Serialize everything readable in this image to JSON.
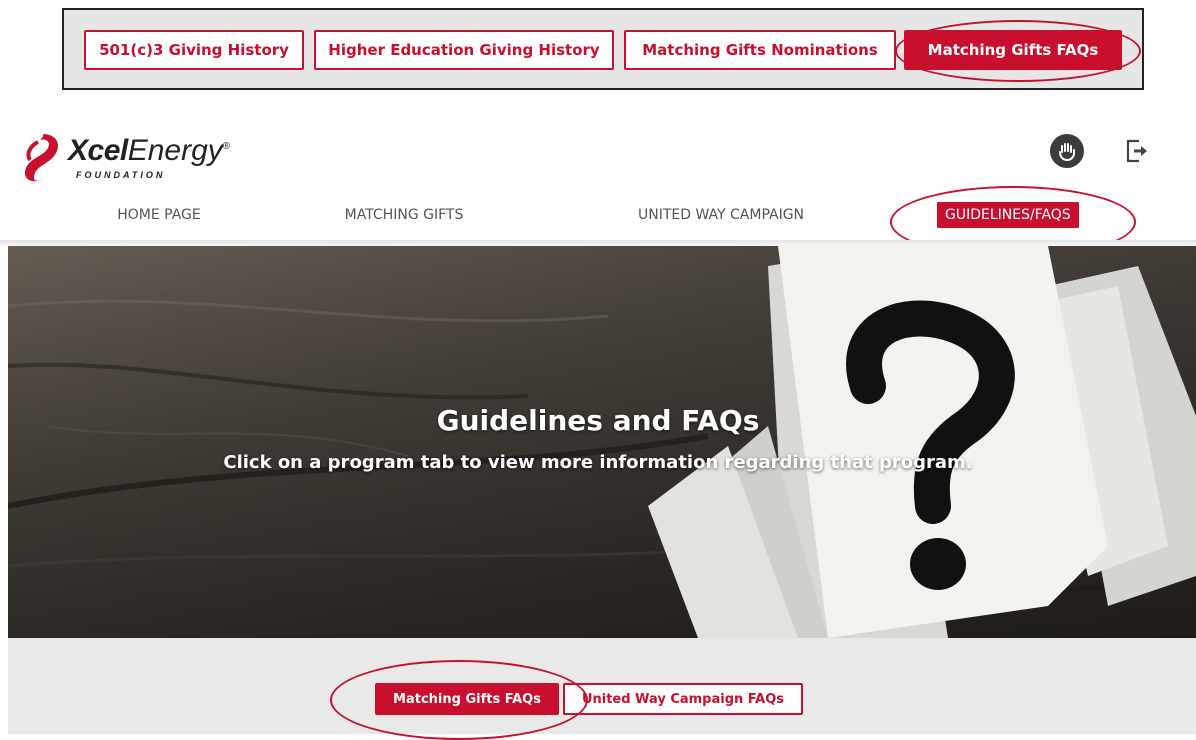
{
  "top_tabs": [
    {
      "label": "501(c)3 Giving History"
    },
    {
      "label": "Higher Education Giving History"
    },
    {
      "label": "Matching Gifts Nominations"
    },
    {
      "label": "Matching Gifts FAQs",
      "active": true
    }
  ],
  "logo": {
    "word1": "Xcel",
    "word2": "Energy",
    "reg": "®",
    "subtitle": "FOUNDATION"
  },
  "header_icons": [
    "accessibility-icon",
    "logout-icon"
  ],
  "nav": [
    {
      "label": "HOME PAGE"
    },
    {
      "label": "MATCHING GIFTS"
    },
    {
      "label": "UNITED WAY CAMPAIGN"
    },
    {
      "label": "GUIDELINES/FAQS",
      "active": true
    }
  ],
  "hero": {
    "title": "Guidelines and FAQs",
    "subtitle": "Click on a program tab to view more information regarding that program."
  },
  "program_tabs": [
    {
      "label": "Matching Gifts FAQs",
      "active": true
    },
    {
      "label": "United Way Campaign FAQs"
    }
  ],
  "colors": {
    "brand_red": "#c8102e",
    "panel_gray": "#e9e9e9",
    "annotation_red": "#c8102e"
  }
}
